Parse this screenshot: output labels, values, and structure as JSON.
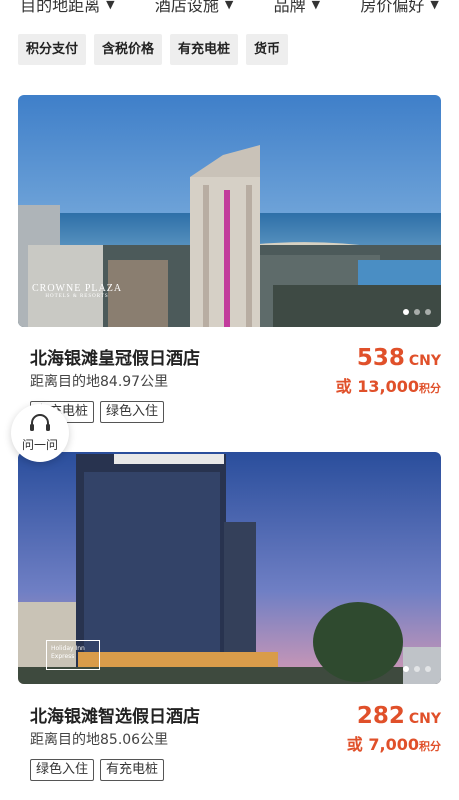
{
  "sort_bar": {
    "items": [
      {
        "label": "目的地距离",
        "icon": "caret-down-icon"
      },
      {
        "label": "酒店设施",
        "icon": "caret-down-icon"
      },
      {
        "label": "品牌",
        "icon": "caret-down-icon"
      },
      {
        "label": "房价偏好",
        "icon": "caret-down-icon"
      }
    ]
  },
  "filters": [
    "积分支付",
    "含税价格",
    "有充电桩",
    "货币"
  ],
  "hotels": [
    {
      "name": "北海银滩皇冠假日酒店",
      "distance": "距离目的地84.97公里",
      "price": "538",
      "currency": "CNY",
      "points_prefix": "或",
      "points": "13,000",
      "points_unit": "积分",
      "tags": [
        "有充电桩",
        "绿色入住"
      ],
      "logo_line1": "CROWNE PLAZA",
      "logo_line2": "HOTELS & RESORTS"
    },
    {
      "name": "北海银滩智选假日酒店",
      "distance": "距离目的地85.06公里",
      "price": "282",
      "currency": "CNY",
      "points_prefix": "或",
      "points": "7,000",
      "points_unit": "积分",
      "tags": [
        "绿色入住",
        "有充电桩"
      ],
      "logo_line1": "Holiday Inn",
      "logo_line2": "Express"
    }
  ],
  "support_button": {
    "label": "问一问",
    "icon": "headset-icon"
  },
  "colors": {
    "price": "#e0502a",
    "chip_bg": "#eeeeee"
  }
}
